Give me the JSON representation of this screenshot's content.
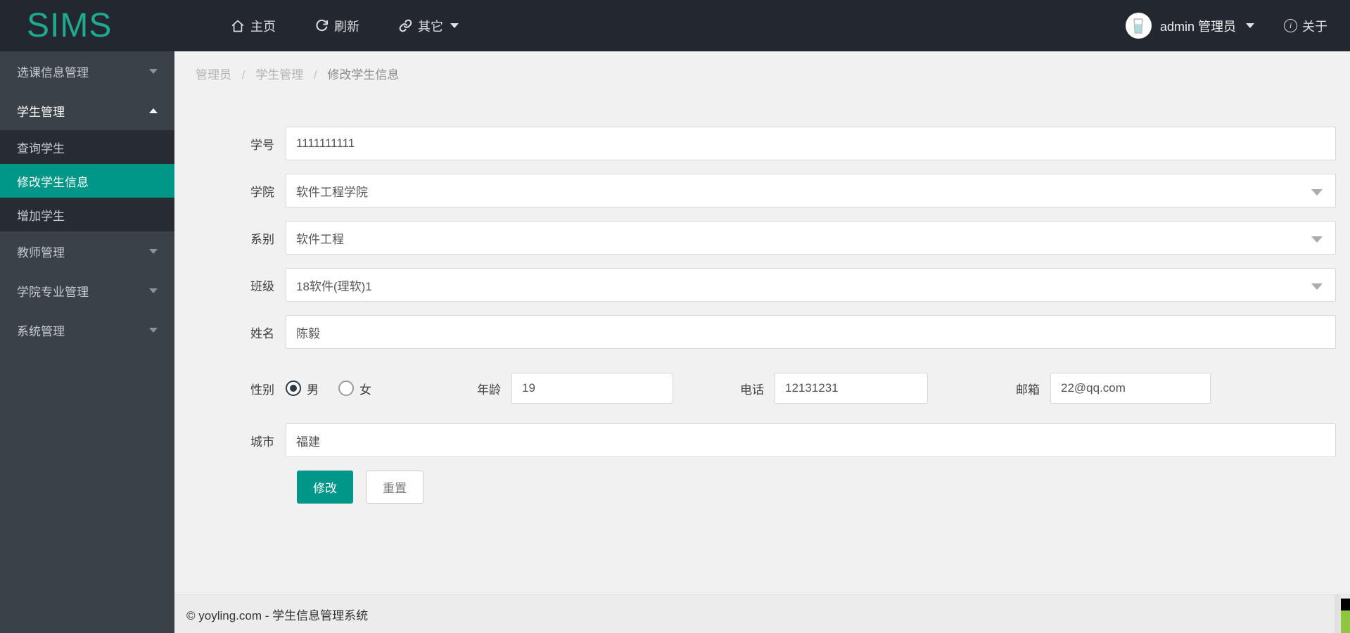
{
  "brand": {
    "logo": "SIMS"
  },
  "navbar": {
    "home": "主页",
    "refresh": "刷新",
    "other": "其它",
    "user_name": "admin 管理员",
    "about": "关于"
  },
  "sidebar": {
    "items": [
      {
        "label": "选课信息管理",
        "state": "collapsed"
      },
      {
        "label": "学生管理",
        "state": "expanded",
        "children": [
          {
            "label": "查询学生",
            "active": false
          },
          {
            "label": "修改学生信息",
            "active": true
          },
          {
            "label": "增加学生",
            "active": false
          }
        ]
      },
      {
        "label": "教师管理",
        "state": "collapsed"
      },
      {
        "label": "学院专业管理",
        "state": "collapsed"
      },
      {
        "label": "系统管理",
        "state": "collapsed"
      }
    ]
  },
  "breadcrumb": {
    "section": "管理员",
    "group": "学生管理",
    "current": "修改学生信息",
    "separator": "/"
  },
  "form": {
    "fields": {
      "student_id": {
        "label": "学号",
        "value": "1111111111"
      },
      "college": {
        "label": "学院",
        "value": "软件工程学院",
        "type": "select"
      },
      "department": {
        "label": "系别",
        "value": "软件工程",
        "type": "select"
      },
      "class": {
        "label": "班级",
        "value": "18软件(理软)1",
        "type": "select"
      },
      "name": {
        "label": "姓名",
        "value": "陈毅"
      },
      "gender": {
        "label": "性别",
        "options": [
          {
            "label": "男",
            "checked": true
          },
          {
            "label": "女",
            "checked": false
          }
        ]
      },
      "age": {
        "label": "年龄",
        "value": "19"
      },
      "phone": {
        "label": "电话",
        "value": "12131231"
      },
      "email": {
        "label": "邮箱",
        "value": "22@qq.com"
      },
      "city": {
        "label": "城市",
        "value": "福建"
      }
    },
    "buttons": {
      "submit": "修改",
      "reset": "重置"
    }
  },
  "footer": {
    "text": "© yoyling.com - 学生信息管理系统"
  },
  "colors": {
    "accent": "#009688",
    "logo": "#1fa98e",
    "navbar_bg": "#232830",
    "sidebar_bg": "#3a4149",
    "submenu_bg": "#272c33",
    "content_bg": "#f1f1f1",
    "artifact_green": "#8dc63f"
  }
}
